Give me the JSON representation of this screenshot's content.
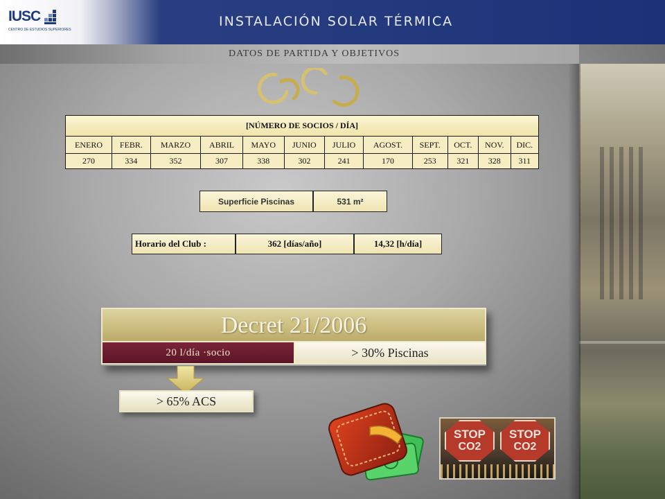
{
  "header": {
    "logo_text": "IUSC",
    "logo_subtext": "CENTRO DE ESTUDIOS SUPERIORES",
    "title": "INSTALACIÓN SOLAR TÉRMICA",
    "subtitle": "DATOS DE PARTIDA Y OBJETIVOS"
  },
  "socios_table": {
    "title": "[NÚMERO DE SOCIOS / DÍA]",
    "months": [
      "ENERO",
      "FEBR.",
      "MARZO",
      "ABRIL",
      "MAYO",
      "JUNIO",
      "JULIO",
      "AGOST.",
      "SEPT.",
      "OCT.",
      "NOV.",
      "DIC."
    ],
    "values": [
      "270",
      "334",
      "352",
      "307",
      "338",
      "302",
      "241",
      "170",
      "253",
      "321",
      "328",
      "311"
    ]
  },
  "superficie": {
    "label": "Superficie Piscinas",
    "value": "531 m²"
  },
  "horario": {
    "label": "Horario del Club :",
    "days": "362 [días/año]",
    "hours": "14,32 [h/día]"
  },
  "decret": {
    "title": "Decret 21/2006",
    "left_condition": "20 l/día ·socio",
    "right_condition": "> 30% Piscinas",
    "acs": "> 65% ACS"
  },
  "stop_image": {
    "sign_text": "STOP",
    "sign_sub": "CO2"
  },
  "colors": {
    "header_blue": "#1c3278",
    "table_fill": "#f6eec2",
    "decret_gold": "#cdbf80",
    "condition_maroon": "#5b1527"
  }
}
